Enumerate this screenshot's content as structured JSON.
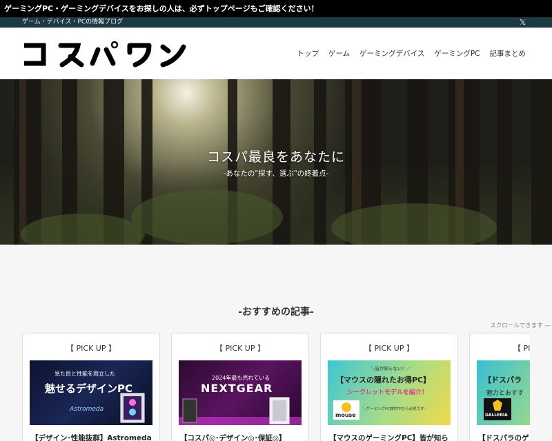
{
  "notice": "ゲーミングPC・ゲーミングデバイスをお探しの人は、必ずトップページもご確認ください！",
  "info_bar": {
    "tagline": "ゲーム・デバイス・PCの情報ブログ",
    "x_icon": "x-logo-icon"
  },
  "logo": {
    "text": "コスパワン"
  },
  "nav": [
    {
      "label": "トップ"
    },
    {
      "label": "ゲーム"
    },
    {
      "label": "ゲーミングデバイス"
    },
    {
      "label": "ゲーミングPC"
    },
    {
      "label": "記事まとめ"
    }
  ],
  "hero": {
    "title": "コスパ最良をあなたに",
    "subtitle": "-あなたの\"探す、選ぶ\"の終着点-"
  },
  "section_title": "-おすすめの記事-",
  "scroll_hint": "スクロールできます ―",
  "cards": [
    {
      "pick": "【 PICK UP 】",
      "title": "【デザイン･性能抜群】Astromeda",
      "thumb": {
        "line1": "見た目と性能を両立した",
        "line2": "魅せるデザインPC",
        "brand": "Astromeda"
      }
    },
    {
      "pick": "【 PICK UP 】",
      "title": "【コスパ◎･デザイン◎･保証◎】",
      "thumb": {
        "line1": "2024年最も売れている",
        "line2": "NEXTGEAR"
      }
    },
    {
      "pick": "【 PICK UP 】",
      "title": "【マウスのゲーミングPC】皆が知ら",
      "thumb": {
        "line0": "＼皆が知らない！／",
        "line1": "【マウスの隠れたお得PC】",
        "line2": "シークレットモデルを紹介！",
        "line3": "＼ゲーミングPC検討中なら必見です／",
        "brand": "mouse"
      }
    },
    {
      "pick": "【 PICK UP 】",
      "title": "【ドスパラのゲ",
      "thumb": {
        "line1": "【ドスパラ",
        "line2": "魅力とおすす",
        "brand": "GALLERIA"
      }
    }
  ]
}
